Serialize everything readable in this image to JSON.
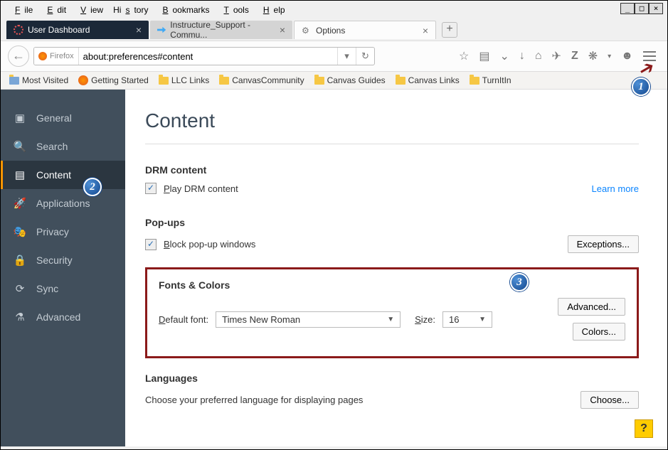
{
  "menubar": [
    "File",
    "Edit",
    "View",
    "History",
    "Bookmarks",
    "Tools",
    "Help"
  ],
  "tabs": [
    {
      "label": "User Dashboard",
      "kind": "dark"
    },
    {
      "label": "Instructure_Support - Commu...",
      "kind": "mid"
    },
    {
      "label": "Options",
      "kind": "active"
    }
  ],
  "url": {
    "branding": "Firefox",
    "value": "about:preferences#content"
  },
  "bookmarks": [
    {
      "label": "Most Visited",
      "icon": "folder"
    },
    {
      "label": "Getting Started",
      "icon": "fox"
    },
    {
      "label": "LLC Links",
      "icon": "folder"
    },
    {
      "label": "CanvasCommunity",
      "icon": "folder"
    },
    {
      "label": "Canvas Guides",
      "icon": "folder"
    },
    {
      "label": "Canvas Links",
      "icon": "folder"
    },
    {
      "label": "TurnItIn",
      "icon": "folder"
    }
  ],
  "sidebar": {
    "items": [
      {
        "label": "General",
        "icon": "⊞"
      },
      {
        "label": "Search",
        "icon": "⌕"
      },
      {
        "label": "Content",
        "icon": "▤",
        "active": true
      },
      {
        "label": "Applications",
        "icon": "✦"
      },
      {
        "label": "Privacy",
        "icon": "❂"
      },
      {
        "label": "Security",
        "icon": "🔒"
      },
      {
        "label": "Sync",
        "icon": "⟳"
      },
      {
        "label": "Advanced",
        "icon": "△"
      }
    ]
  },
  "page": {
    "heading": "Content",
    "drm": {
      "title": "DRM content",
      "check_label": "Play DRM content",
      "learn": "Learn more"
    },
    "popups": {
      "title": "Pop-ups",
      "check_label": "Block pop-up windows",
      "exceptions": "Exceptions..."
    },
    "fonts": {
      "title": "Fonts & Colors",
      "default_label": "Default font:",
      "default_value": "Times New Roman",
      "size_label": "Size:",
      "size_value": "16",
      "advanced": "Advanced...",
      "colors": "Colors..."
    },
    "lang": {
      "title": "Languages",
      "desc": "Choose your preferred language for displaying pages",
      "choose": "Choose..."
    }
  },
  "annotations": {
    "a1": "1",
    "a2": "2",
    "a3": "3"
  }
}
